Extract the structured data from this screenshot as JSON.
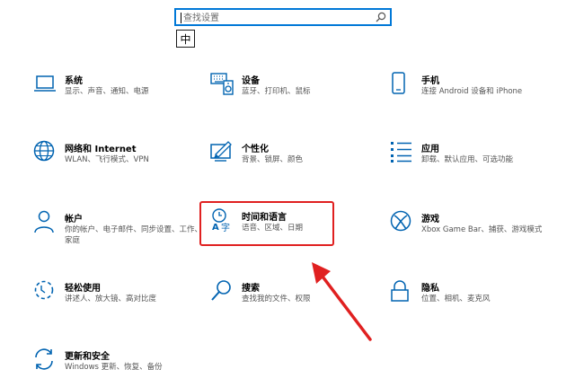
{
  "search": {
    "placeholder": "查找设置"
  },
  "ime_indicator": "中",
  "colors": {
    "accent": "#0078d7",
    "highlight": "#e02020"
  },
  "tiles": [
    {
      "title": "系统",
      "desc": "显示、声音、通知、电源",
      "icon": "laptop-icon"
    },
    {
      "title": "设备",
      "desc": "蓝牙、打印机、鼠标",
      "icon": "keyboard-speaker-icon"
    },
    {
      "title": "手机",
      "desc": "连接 Android 设备和 iPhone",
      "icon": "phone-icon"
    },
    {
      "title": "网络和 Internet",
      "desc": "WLAN、飞行模式、VPN",
      "icon": "globe-icon"
    },
    {
      "title": "个性化",
      "desc": "背景、锁屏、颜色",
      "icon": "paint-monitor-icon"
    },
    {
      "title": "应用",
      "desc": "卸载、默认应用、可选功能",
      "icon": "apps-list-icon"
    },
    {
      "title": "帐户",
      "desc": "你的帐户、电子邮件、同步设置、工作、家庭",
      "icon": "person-icon"
    },
    {
      "title": "时间和语言",
      "desc": "语音、区域、日期",
      "icon": "time-language-icon"
    },
    {
      "title": "游戏",
      "desc": "Xbox Game Bar、捕获、游戏模式",
      "icon": "xbox-icon"
    },
    {
      "title": "轻松使用",
      "desc": "讲述人、放大镜、高对比度",
      "icon": "ease-of-access-icon"
    },
    {
      "title": "搜索",
      "desc": "查找我的文件、权限",
      "icon": "magnifier-icon"
    },
    {
      "title": "隐私",
      "desc": "位置、相机、麦克风",
      "icon": "lock-icon"
    },
    {
      "title": "更新和安全",
      "desc": "Windows 更新、恢复、备份",
      "icon": "sync-icon"
    }
  ]
}
